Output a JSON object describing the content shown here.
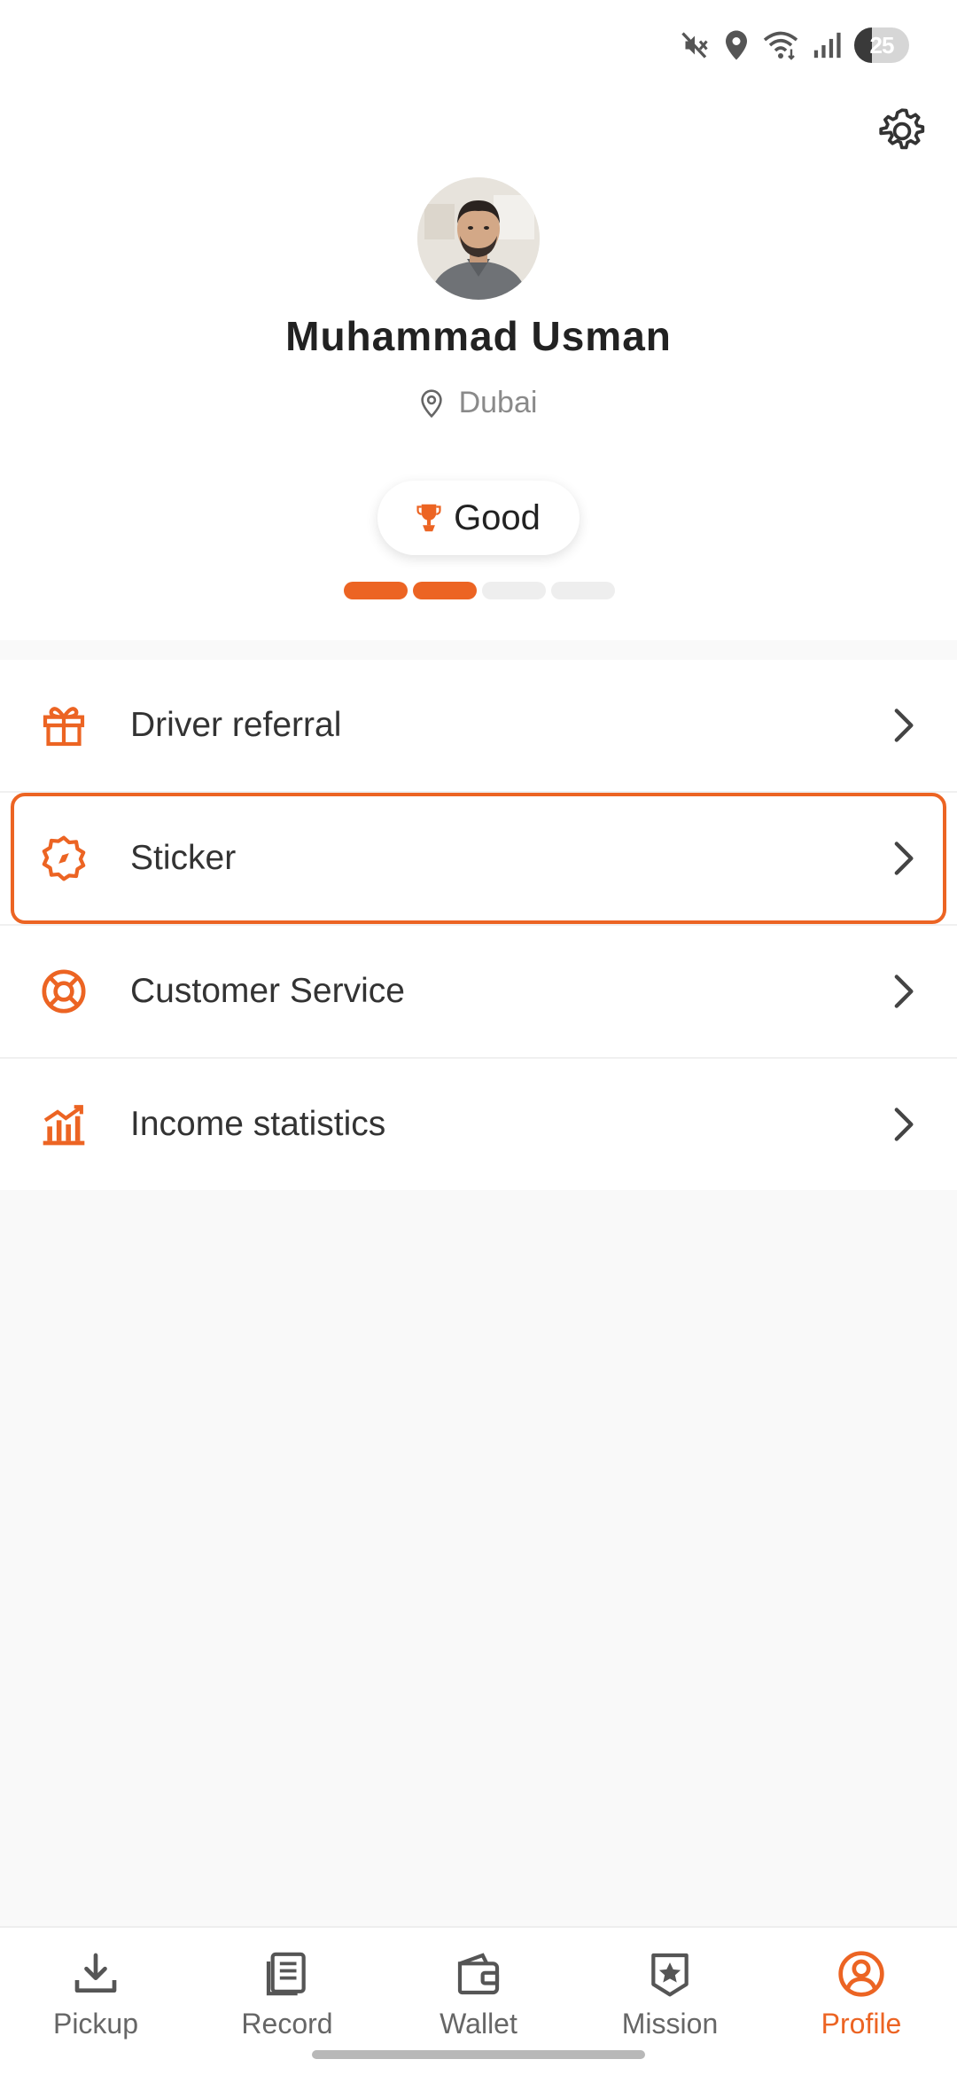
{
  "status_bar": {
    "battery": "25",
    "icons": [
      "mute-icon",
      "location-icon",
      "wifi-icon",
      "signal-icon",
      "battery-icon"
    ]
  },
  "profile": {
    "name": "Muhammad Usman",
    "location": "Dubai",
    "rating": "Good",
    "level": 2,
    "level_max": 4
  },
  "menu": {
    "items": [
      {
        "label": "Driver referral",
        "icon": "gift-icon"
      },
      {
        "label": "Sticker",
        "icon": "badge-icon"
      },
      {
        "label": "Customer Service",
        "icon": "lifebuoy-icon"
      },
      {
        "label": "Income statistics",
        "icon": "bar-chart-icon"
      }
    ]
  },
  "bottom_nav": {
    "items": [
      {
        "label": "Pickup",
        "icon": "download-icon"
      },
      {
        "label": "Record",
        "icon": "document-icon"
      },
      {
        "label": "Wallet",
        "icon": "wallet-icon"
      },
      {
        "label": "Mission",
        "icon": "star-shield-icon"
      },
      {
        "label": "Profile",
        "icon": "user-circle-icon"
      }
    ],
    "active": "Profile"
  },
  "colors": {
    "accent": "#ec6423",
    "text": "#222222",
    "muted": "#8a8a8a",
    "background": "#f9f9f9"
  }
}
